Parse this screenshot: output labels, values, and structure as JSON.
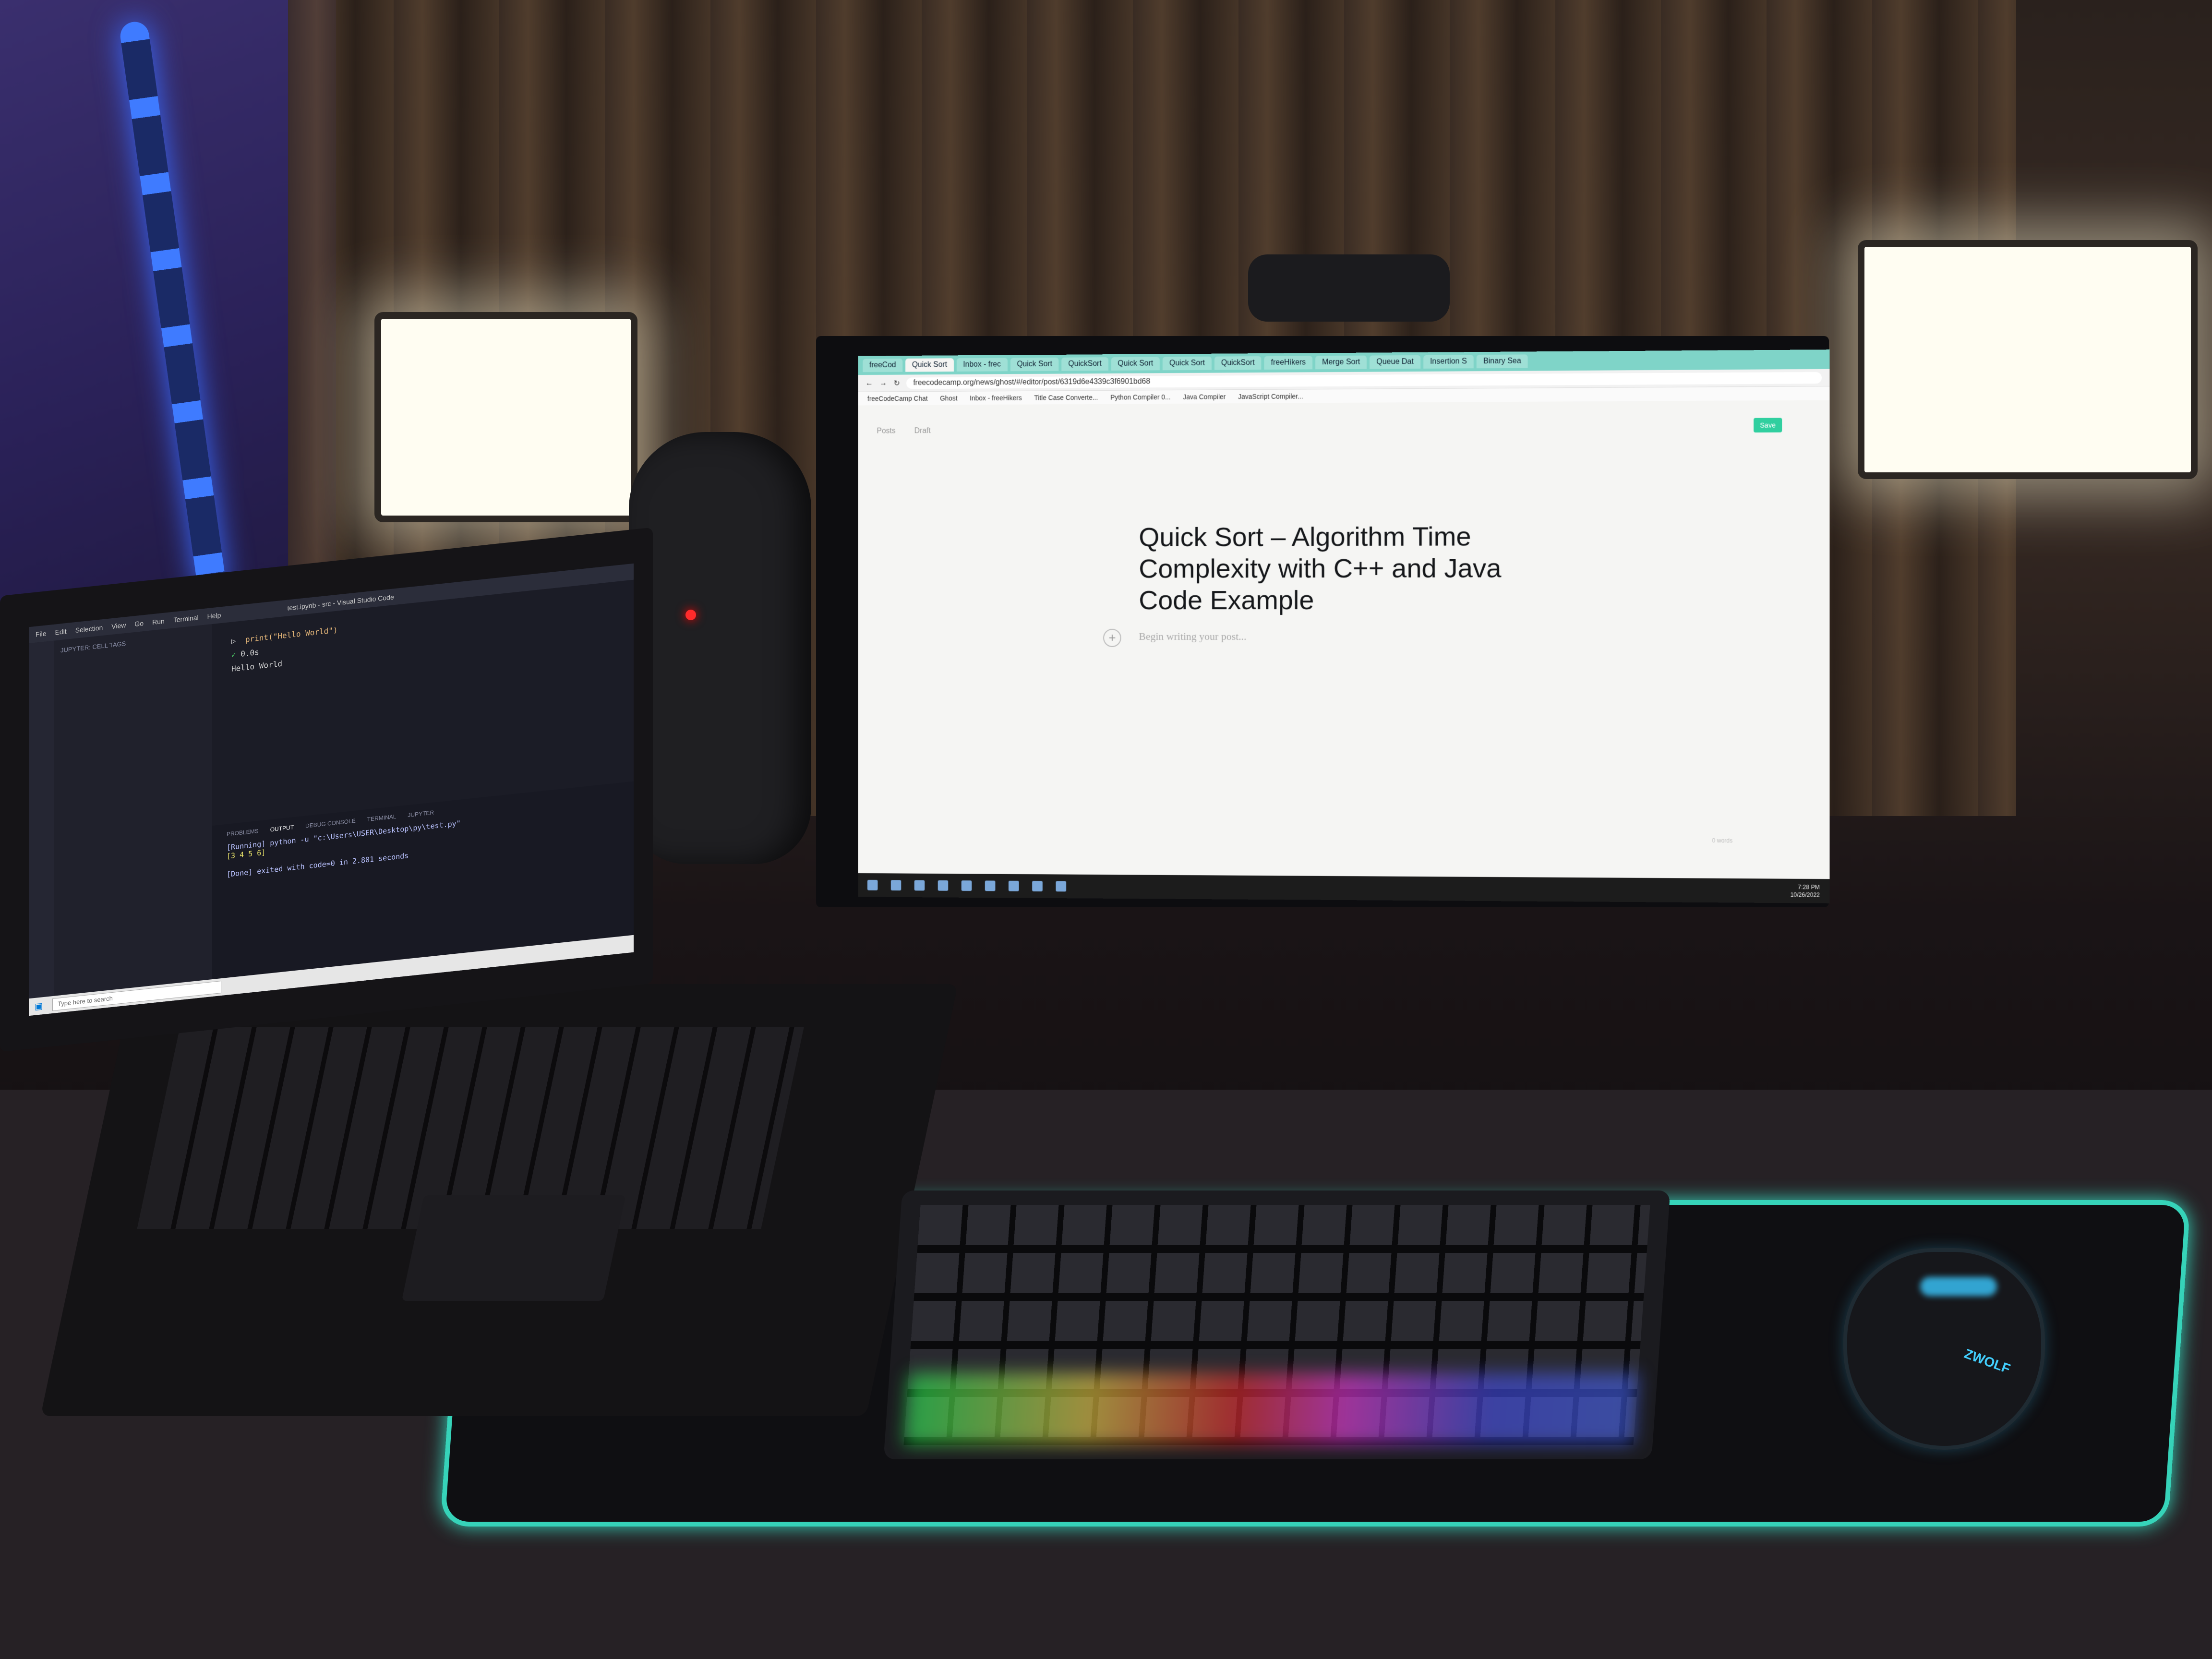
{
  "browser": {
    "tabs": [
      "freeCod",
      "Quick Sort",
      "Inbox - frec",
      "Quick Sort",
      "QuickSort",
      "Quick Sort",
      "Quick Sort",
      "QuickSort",
      "freeHikers",
      "Merge Sort",
      "Queue Dat",
      "Insertion S",
      "Binary Sea"
    ],
    "url": "freecodecamp.org/news/ghost/#/editor/post/6319d6e4339c3f6901bd68",
    "bookmarks": [
      "freeCodeCamp Chat",
      "Ghost",
      "Inbox - freeHikers",
      "Title Case Converte...",
      "Python Compiler 0...",
      "Java Compiler",
      "JavaScript Compiler..."
    ]
  },
  "editor": {
    "nav": [
      "Posts",
      "Draft"
    ],
    "save_label": "Save",
    "title": "Quick Sort – Algorithm Time Complexity with C++ and Java Code Example",
    "body_placeholder": "Begin writing your post...",
    "word_count": "0 words"
  },
  "taskbar": {
    "time": "7:28 PM",
    "date": "10/26/2022"
  },
  "vscode": {
    "title": "test.ipynb - src - Visual Studio Code",
    "menu": [
      "File",
      "Edit",
      "Selection",
      "View",
      "Go",
      "Run",
      "Terminal",
      "Help"
    ],
    "explorer_header": "JUPYTER: CELL TAGS",
    "code_line": "print(\"Hello World\")",
    "cell_time": "0.0s",
    "cell_output": "Hello World",
    "panel_tabs": [
      "PROBLEMS",
      "OUTPUT",
      "DEBUG CONSOLE",
      "TERMINAL",
      "JUPYTER"
    ],
    "out_line1": "[Running] python -u \"c:\\Users\\USER\\Desktop\\py\\test.py\"",
    "out_line2": "[3 4 5 6]",
    "out_line3": "[Done] exited with code=0 in 2.801 seconds",
    "search_placeholder": "Type here to search"
  },
  "mouse_brand": "ZWOLF",
  "colors": {
    "browser_tabbar": "#7fd4c8",
    "save_button": "#30cf9f",
    "mousepad_glow": "#36d3b9",
    "led_strip": "#3f7bff"
  }
}
